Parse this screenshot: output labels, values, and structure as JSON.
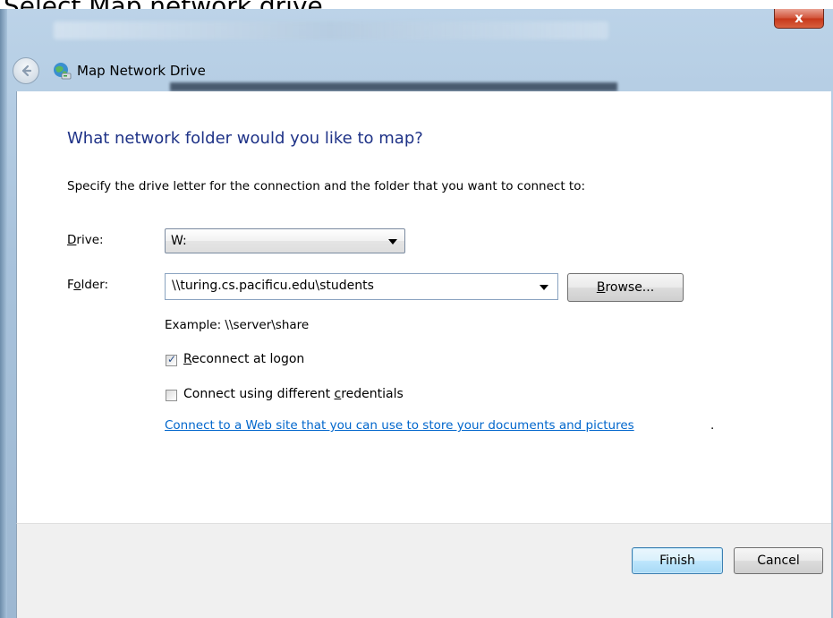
{
  "caption": "Select Map network drive",
  "window": {
    "close_label": "x",
    "title": "Map Network Drive"
  },
  "dialog": {
    "heading": "What network folder would you like to map?",
    "instructions": "Specify the drive letter for the connection and the folder that you want to connect to:",
    "drive": {
      "label_pre": "",
      "label_accel": "D",
      "label_post": "rive:",
      "value": "W:"
    },
    "folder": {
      "label_pre": "F",
      "label_accel": "o",
      "label_post": "lder:",
      "value": "\\\\turing.cs.pacificu.edu\\students"
    },
    "browse": {
      "accel": "B",
      "rest": "rowse..."
    },
    "example": "Example: \\\\server\\share",
    "reconnect": {
      "checked": true,
      "accel": "R",
      "rest": "econnect at logon"
    },
    "credentials": {
      "checked": false,
      "pre": "Connect using different ",
      "accel": "c",
      "post": "redentials"
    },
    "web_link": "Connect to a Web site that you can use to store your documents and pictures",
    "web_link_period": "."
  },
  "footer": {
    "finish_label": "Finish",
    "cancel_label": "Cancel"
  },
  "colors": {
    "heading": "#1e3287",
    "link": "#0066cc",
    "close": "#c7371a"
  }
}
